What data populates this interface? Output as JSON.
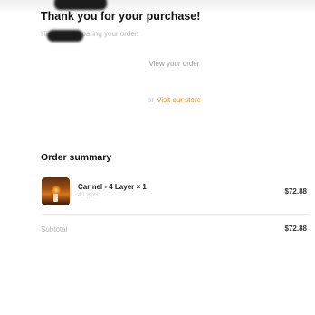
{
  "confirmation": {
    "title": "Thank you for your purchase!",
    "subline": "Hi, we're Preparing your order."
  },
  "links": {
    "view_order": "View your order",
    "or": "or",
    "visit_store": "Visit our store"
  },
  "order_summary": {
    "heading": "Order summary",
    "items": [
      {
        "name": "Carmel - 4 Layer × 1",
        "variant": "4 Layer",
        "price": "$72.88",
        "thumbnail": "candle-product-image"
      }
    ],
    "subtotal_label": "Subtotal",
    "subtotal_value": "$72.88"
  },
  "colors": {
    "accent_link": "#f08a1c",
    "title_text": "#111111",
    "muted_text": "#b5b5b5"
  }
}
